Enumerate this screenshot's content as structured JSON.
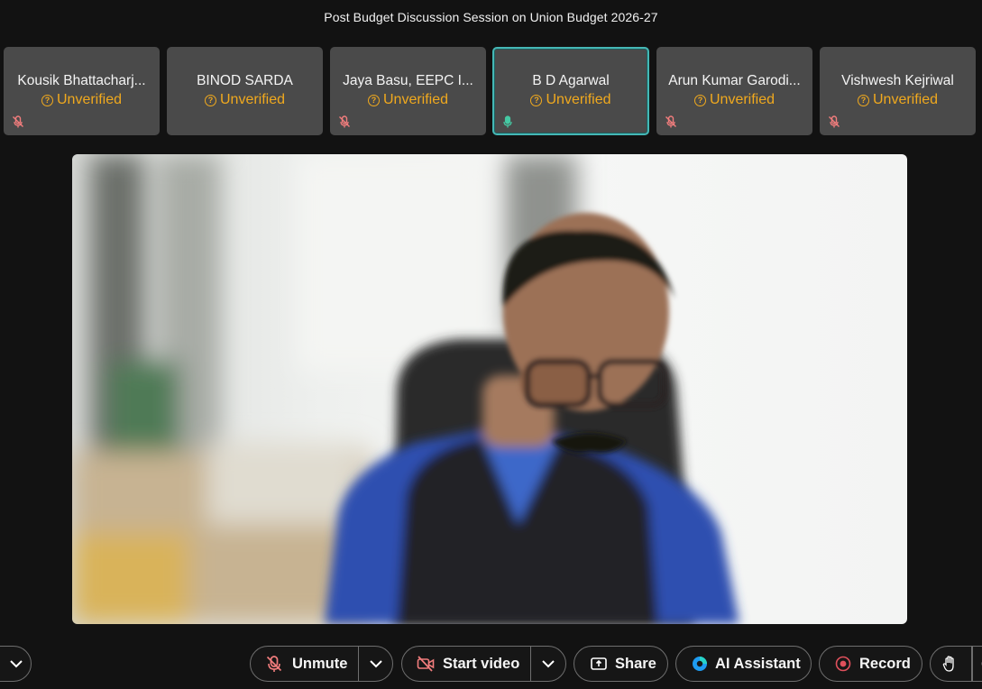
{
  "meeting": {
    "title": "Post Budget Discussion Session on Union Budget 2026-27"
  },
  "participants": [
    {
      "name": "Kousik Bhattacharj...",
      "status": "Unverified",
      "mic": "muted",
      "active": false
    },
    {
      "name": "BINOD SARDA",
      "status": "Unverified",
      "mic": "none",
      "active": false
    },
    {
      "name": "Jaya Basu, EEPC I...",
      "status": "Unverified",
      "mic": "muted",
      "active": false
    },
    {
      "name": "B D Agarwal",
      "status": "Unverified",
      "mic": "on",
      "active": true
    },
    {
      "name": "Arun Kumar Garodi...",
      "status": "Unverified",
      "mic": "muted",
      "active": false
    },
    {
      "name": "Vishwesh Kejriwal",
      "status": "Unverified",
      "mic": "muted",
      "active": false
    }
  ],
  "toolbar": {
    "unmute_label": "Unmute",
    "start_video_label": "Start video",
    "share_label": "Share",
    "ai_assistant_label": "AI Assistant",
    "record_label": "Record"
  },
  "colors": {
    "accent_active": "#45b7b5",
    "unverified": "#f0a91e",
    "muted_icon": "#f27d7d",
    "record_dot": "#e0505c",
    "ai_blue": "#1e9bf0"
  }
}
